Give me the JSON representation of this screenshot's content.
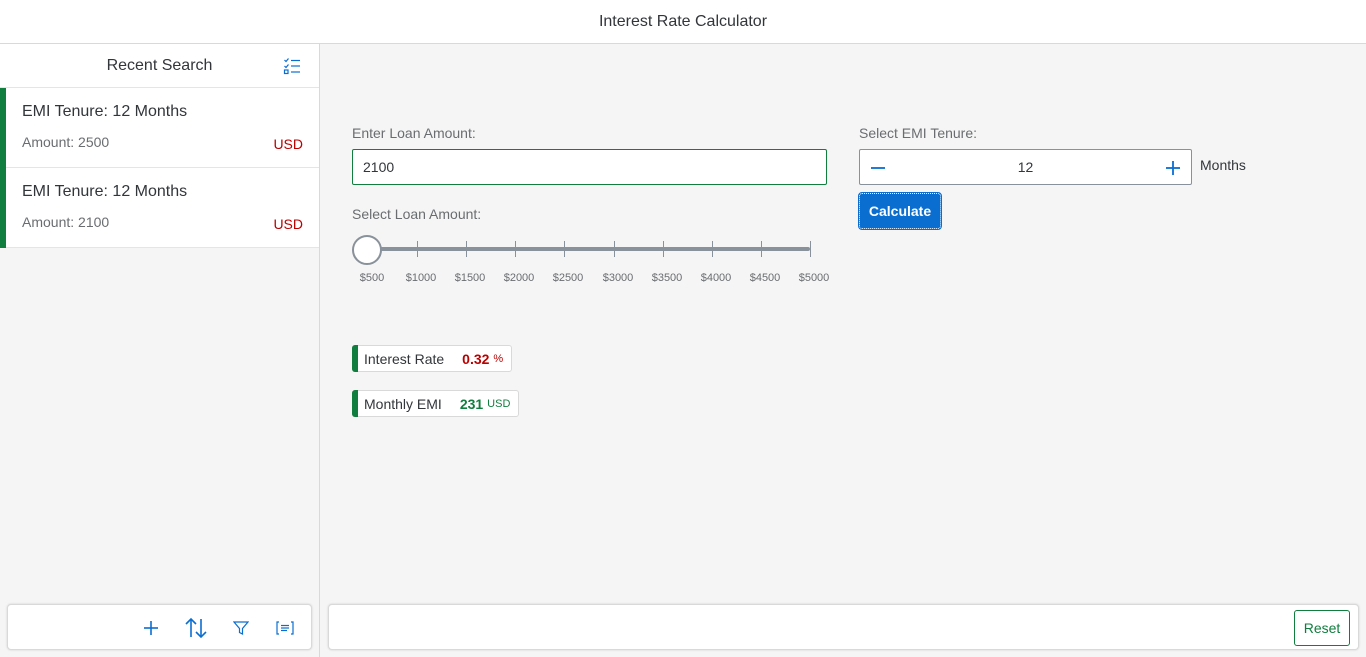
{
  "app": {
    "title": "Interest Rate Calculator"
  },
  "master": {
    "title": "Recent Search",
    "header_icon": "multi-select-icon",
    "items": [
      {
        "title": "EMI Tenure: 12 Months",
        "amount": "Amount: 2500",
        "currency": "USD"
      },
      {
        "title": "EMI Tenure: 12 Months",
        "amount": "Amount: 2100",
        "currency": "USD"
      }
    ],
    "footer_icons": [
      "add-icon",
      "sort-icon",
      "filter-icon",
      "group-icon"
    ]
  },
  "form": {
    "loan_amount_label": "Enter Loan Amount:",
    "loan_amount_value": "2100",
    "slider_label": "Select Loan Amount:",
    "slider_ticks": [
      "$500",
      "$1000",
      "$1500",
      "$2000",
      "$2500",
      "$3000",
      "$3500",
      "$4000",
      "$4500",
      "$5000"
    ],
    "slider_min": 500,
    "slider_max": 5000,
    "tenure_label": "Select EMI Tenure:",
    "tenure_value": "12",
    "tenure_unit": "Months",
    "calculate_label": "Calculate"
  },
  "results": {
    "interest_rate": {
      "label": "Interest Rate",
      "value": "0.32",
      "unit": "%"
    },
    "monthly_emi": {
      "label": "Monthly EMI",
      "value": "231",
      "unit": "USD"
    }
  },
  "footer": {
    "reset_label": "Reset"
  },
  "colors": {
    "positive": "#107e3e",
    "negative": "#bb0000",
    "brand": "#0a6ed1"
  }
}
